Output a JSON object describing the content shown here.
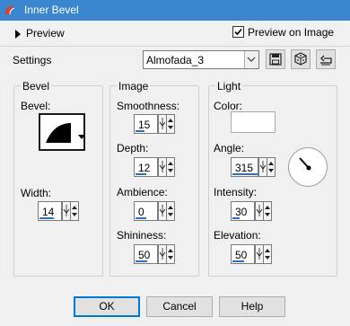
{
  "window": {
    "title": "Inner Bevel"
  },
  "preview_toggle": {
    "label": "Preview"
  },
  "preview_on_image": {
    "label": "Preview on Image",
    "checked": true
  },
  "settings": {
    "label": "Settings",
    "value": "Almofada_3"
  },
  "groups": {
    "bevel": {
      "title": "Bevel",
      "bevel_label": "Bevel:",
      "width_label": "Width:",
      "width_value": "14"
    },
    "image": {
      "title": "Image",
      "smoothness_label": "Smoothness:",
      "smoothness_value": "15",
      "depth_label": "Depth:",
      "depth_value": "12",
      "ambience_label": "Ambience:",
      "ambience_value": "0",
      "shininess_label": "Shininess:",
      "shininess_value": "50"
    },
    "light": {
      "title": "Light",
      "color_label": "Color:",
      "color_value": "#ffffff",
      "angle_label": "Angle:",
      "angle_value": "315",
      "intensity_label": "Intensity:",
      "intensity_value": "30",
      "elevation_label": "Elevation:",
      "elevation_value": "50"
    }
  },
  "buttons": {
    "ok": "OK",
    "cancel": "Cancel",
    "help": "Help"
  },
  "accent": "#2a6fc9",
  "title_bar_color": "#3a86cf"
}
